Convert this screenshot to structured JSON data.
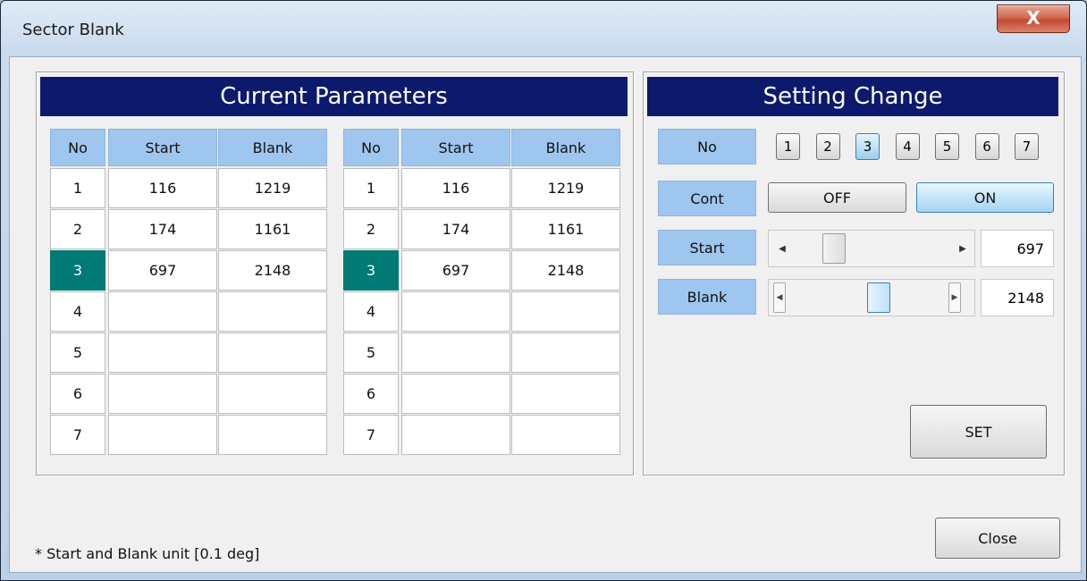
{
  "window": {
    "title": "Sector Blank",
    "close_glyph": "X"
  },
  "current": {
    "heading": "Current Parameters",
    "columns": [
      "No",
      "Start",
      "Blank"
    ],
    "selected_row": 3,
    "tables": [
      {
        "rows": [
          {
            "no": "1",
            "start": "116",
            "blank": "1219"
          },
          {
            "no": "2",
            "start": "174",
            "blank": "1161"
          },
          {
            "no": "3",
            "start": "697",
            "blank": "2148"
          },
          {
            "no": "4",
            "start": "",
            "blank": ""
          },
          {
            "no": "5",
            "start": "",
            "blank": ""
          },
          {
            "no": "6",
            "start": "",
            "blank": ""
          },
          {
            "no": "7",
            "start": "",
            "blank": ""
          }
        ]
      },
      {
        "rows": [
          {
            "no": "1",
            "start": "116",
            "blank": "1219"
          },
          {
            "no": "2",
            "start": "174",
            "blank": "1161"
          },
          {
            "no": "3",
            "start": "697",
            "blank": "2148"
          },
          {
            "no": "4",
            "start": "",
            "blank": ""
          },
          {
            "no": "5",
            "start": "",
            "blank": ""
          },
          {
            "no": "6",
            "start": "",
            "blank": ""
          },
          {
            "no": "7",
            "start": "",
            "blank": ""
          }
        ]
      }
    ]
  },
  "setting": {
    "heading": "Setting Change",
    "labels": {
      "no": "No",
      "cont": "Cont",
      "start": "Start",
      "blank": "Blank"
    },
    "numbers": [
      "1",
      "2",
      "3",
      "4",
      "5",
      "6",
      "7"
    ],
    "selected_number": "3",
    "cont_off": "OFF",
    "cont_on": "ON",
    "cont_state": "ON",
    "start_value": "697",
    "blank_value": "2148",
    "set_label": "SET"
  },
  "footer": {
    "note": "* Start and Blank unit [0.1 deg]",
    "close_label": "Close"
  },
  "colors": {
    "header_bg": "#0c1a6e",
    "col_header": "#9fc6ee",
    "selected": "#007a74"
  }
}
